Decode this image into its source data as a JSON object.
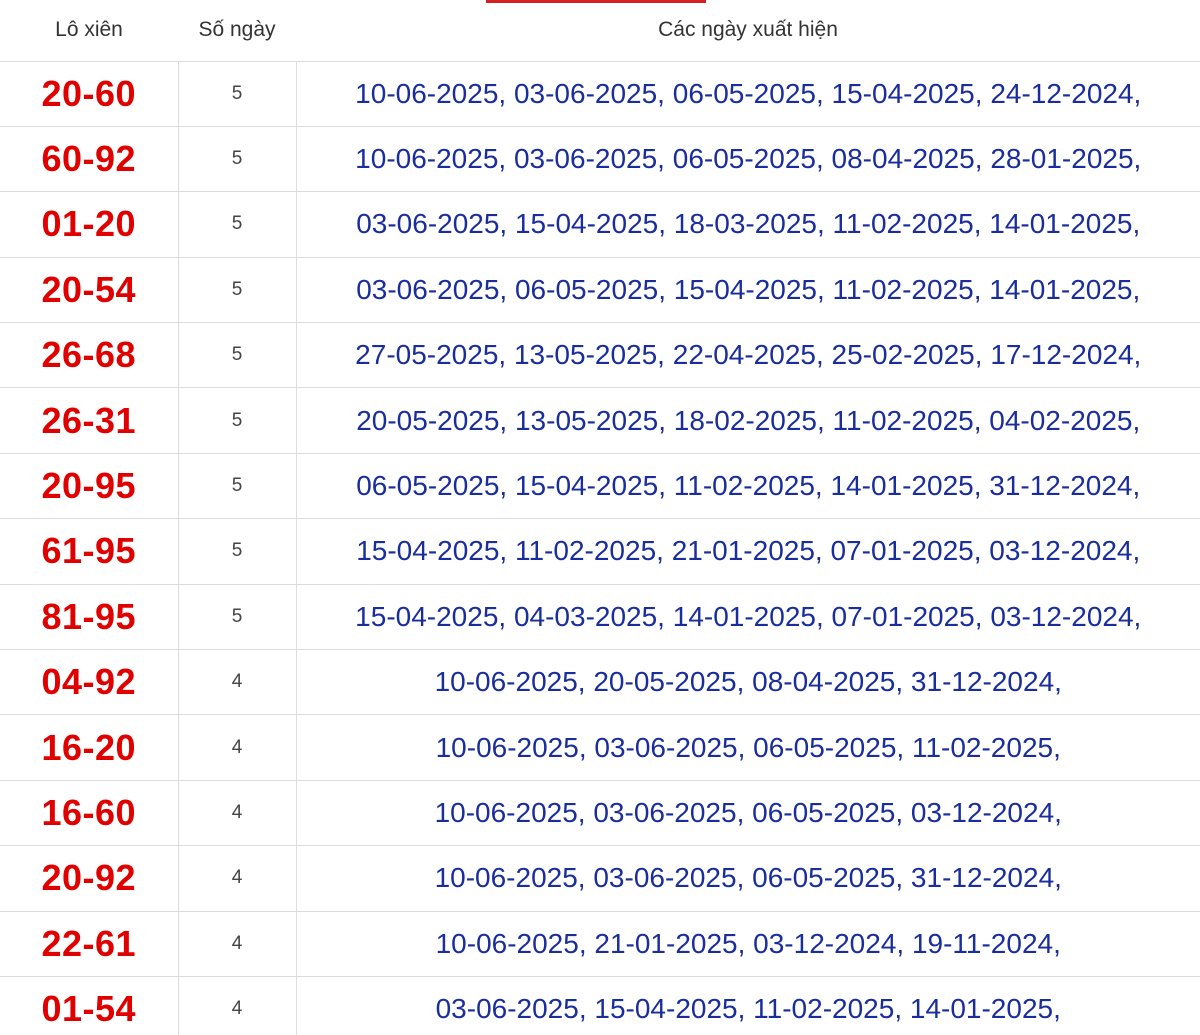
{
  "table": {
    "headers": {
      "pair": "Lô xiên",
      "count": "Số ngày",
      "dates": "Các ngày xuất hiện"
    },
    "rows": [
      {
        "pair": "20-60",
        "count": "5",
        "dates": "10-06-2025, 03-06-2025, 06-05-2025, 15-04-2025, 24-12-2024,"
      },
      {
        "pair": "60-92",
        "count": "5",
        "dates": "10-06-2025, 03-06-2025, 06-05-2025, 08-04-2025, 28-01-2025,"
      },
      {
        "pair": "01-20",
        "count": "5",
        "dates": "03-06-2025, 15-04-2025, 18-03-2025, 11-02-2025, 14-01-2025,"
      },
      {
        "pair": "20-54",
        "count": "5",
        "dates": "03-06-2025, 06-05-2025, 15-04-2025, 11-02-2025, 14-01-2025,"
      },
      {
        "pair": "26-68",
        "count": "5",
        "dates": "27-05-2025, 13-05-2025, 22-04-2025, 25-02-2025, 17-12-2024,"
      },
      {
        "pair": "26-31",
        "count": "5",
        "dates": "20-05-2025, 13-05-2025, 18-02-2025, 11-02-2025, 04-02-2025,"
      },
      {
        "pair": "20-95",
        "count": "5",
        "dates": "06-05-2025, 15-04-2025, 11-02-2025, 14-01-2025, 31-12-2024,"
      },
      {
        "pair": "61-95",
        "count": "5",
        "dates": "15-04-2025, 11-02-2025, 21-01-2025, 07-01-2025, 03-12-2024,"
      },
      {
        "pair": "81-95",
        "count": "5",
        "dates": "15-04-2025, 04-03-2025, 14-01-2025, 07-01-2025, 03-12-2024,"
      },
      {
        "pair": "04-92",
        "count": "4",
        "dates": "10-06-2025, 20-05-2025, 08-04-2025, 31-12-2024,"
      },
      {
        "pair": "16-20",
        "count": "4",
        "dates": "10-06-2025, 03-06-2025, 06-05-2025, 11-02-2025,"
      },
      {
        "pair": "16-60",
        "count": "4",
        "dates": "10-06-2025, 03-06-2025, 06-05-2025, 03-12-2024,"
      },
      {
        "pair": "20-92",
        "count": "4",
        "dates": "10-06-2025, 03-06-2025, 06-05-2025, 31-12-2024,"
      },
      {
        "pair": "22-61",
        "count": "4",
        "dates": "10-06-2025, 21-01-2025, 03-12-2024, 19-11-2024,"
      },
      {
        "pair": "01-54",
        "count": "4",
        "dates": "03-06-2025, 15-04-2025, 11-02-2025, 14-01-2025,"
      }
    ]
  },
  "colors": {
    "pair_red": "#e00000",
    "date_blue": "#1a2d9c",
    "tab_accent": "#d42020",
    "border": "#dcdcdc"
  }
}
